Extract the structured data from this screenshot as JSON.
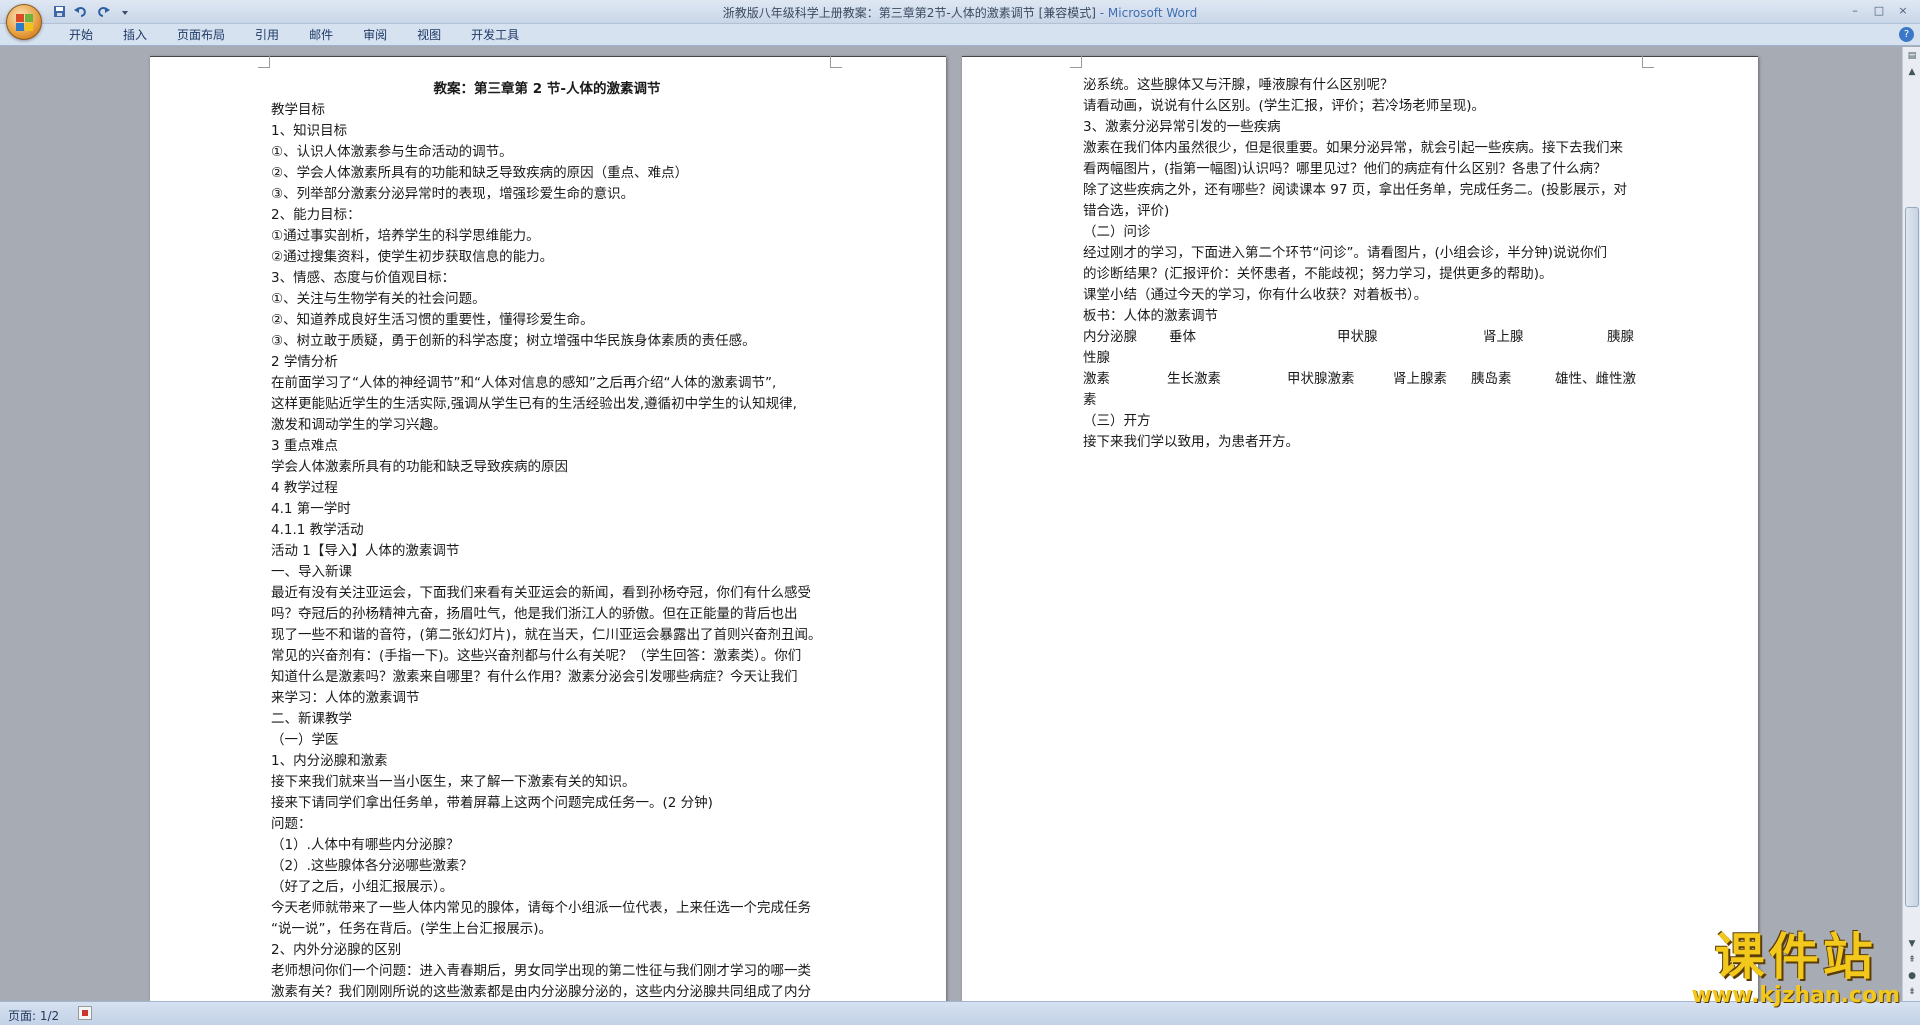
{
  "window": {
    "title": "浙教版八年级科学上册教案：第三章第2节-人体的激素调节 [兼容模式]",
    "app_name": " - Microsoft Word",
    "controls": [
      "–",
      "□",
      "×"
    ]
  },
  "quick_access": [
    "save-icon",
    "undo-icon",
    "redo-icon",
    "customize-icon"
  ],
  "ribbon": {
    "tabs": [
      "开始",
      "插入",
      "页面布局",
      "引用",
      "邮件",
      "审阅",
      "视图",
      "开发工具"
    ]
  },
  "page1": {
    "title": "教案：第三章第 2 节-人体的激素调节",
    "lines": [
      "教学目标 ",
      "1、知识目标",
      "①、认识人体激素参与生命活动的调节。",
      "②、学会人体激素所具有的功能和缺乏导致疾病的原因（重点、难点）",
      "③、列举部分激素分泌异常时的表现，增强珍爱生命的意识。",
      "2、能力目标：",
      "①通过事实剖析，培养学生的科学思维能力。",
      "②通过搜集资料，使学生初步获取信息的能力。",
      "3、情感、态度与价值观目标：",
      "①、关注与生物学有关的社会问题。",
      "②、知道养成良好生活习惯的重要性，懂得珍爱生命。",
      "③、树立敢于质疑，勇于创新的科学态度；树立增强中华民族身体素质的责任感。",
      "2 学情分析 ",
      "在前面学习了“人体的神经调节”和“人体对信息的感知”之后再介绍“人体的激素调节”,",
      "这样更能贴近学生的生活实际,强调从学生已有的生活经验出发,遵循初中学生的认知规律,",
      "激发和调动学生的学习兴趣。",
      "3 重点难点 ",
      "学会人体激素所具有的功能和缺乏导致疾病的原因",
      "4 教学过程",
      "4.1 第一学时",
      "4.1.1 教学活动",
      "活动 1【导入】人体的激素调节 ",
      "一、导入新课",
      "最近有没有关注亚运会，下面我们来看有关亚运会的新闻，看到孙杨夺冠，你们有什么感受",
      "吗？夺冠后的孙杨精神亢奋，扬眉吐气，他是我们浙江人的骄傲。但在正能量的背后也出",
      "现了一些不和谐的音符，(第二张幻灯片)，就在当天，仁川亚运会暴露出了首则兴奋剂丑闻。",
      "常见的兴奋剂有：(手指一下)。这些兴奋剂都与什么有关呢？（学生回答：激素类）。你们",
      "知道什么是激素吗？激素来自哪里？有什么作用？激素分泌会引发哪些病症？今天让我们",
      "来学习：人体的激素调节",
      "二、新课教学",
      "（一）学医",
      "1、内分泌腺和激素",
      "接下来我们就来当一当小医生，来了解一下激素有关的知识。",
      "接来下请同学们拿出任务单，带着屏幕上这两个问题完成任务一。(2 分钟)",
      "问题：",
      "（1）.人体中有哪些内分泌腺？",
      "（2）.这些腺体各分泌哪些激素？",
      "（好了之后，小组汇报展示）。",
      "今天老师就带来了一些人体内常见的腺体，请每个小组派一位代表，上来任选一个完成任务",
      "“说一说”，任务在背后。(学生上台汇报展示)。",
      "2、内外分泌腺的区别",
      "老师想问你们一个问题：进入青春期后，男女同学出现的第二性征与我们刚才学习的哪一类",
      "激素有关？我们刚刚所说的这些激素都是由内分泌腺分泌的，这些内分泌腺共同组成了内分"
    ]
  },
  "page2": {
    "lines_top": [
      "泌系统。这些腺体又与汗腺，唾液腺有什么区别呢？",
      "请看动画，说说有什么区别。(学生汇报，评价；若冷场老师呈现)。",
      "3、激素分泌异常引发的一些疾病",
      "激素在我们体内虽然很少，但是很重要。如果分泌异常，就会引起一些疾病。接下去我们来",
      "看两幅图片，(指第一幅图)认识吗？哪里见过？他们的病症有什么区别？各患了什么病？",
      "除了这些疾病之外，还有哪些？阅读课本 97 页，拿出任务单，完成任务二。(投影展示，对",
      "错合选，评价)",
      "（二）问诊",
      "经过刚才的学习，下面进入第二个环节“问诊”。请看图片，(小组会诊，半分钟)说说你们",
      "的诊断结果？(汇报评价：关怀患者，不能歧视；努力学习，提供更多的帮助)。",
      "课堂小结（通过今天的学习，你有什么收获？对着板书）。",
      "板书：人体的激素调节"
    ],
    "table_row1": [
      "内分泌腺",
      "垂体",
      "甲状腺",
      "肾上腺",
      "胰腺"
    ],
    "table_row1_wrap": "性腺",
    "table_row2": [
      "激素",
      "生长激素",
      "甲状腺激素",
      "肾上腺素",
      "胰岛素",
      "雄性、雌性激"
    ],
    "table_row2_wrap": "素",
    "lines_bottom": [
      "（三）开方",
      "接下来我们学以致用，为患者开方。"
    ]
  },
  "status": {
    "page_count": "页面: 1/2"
  },
  "watermark": {
    "cn": "课件站",
    "url": "www.kjzhan.com"
  }
}
